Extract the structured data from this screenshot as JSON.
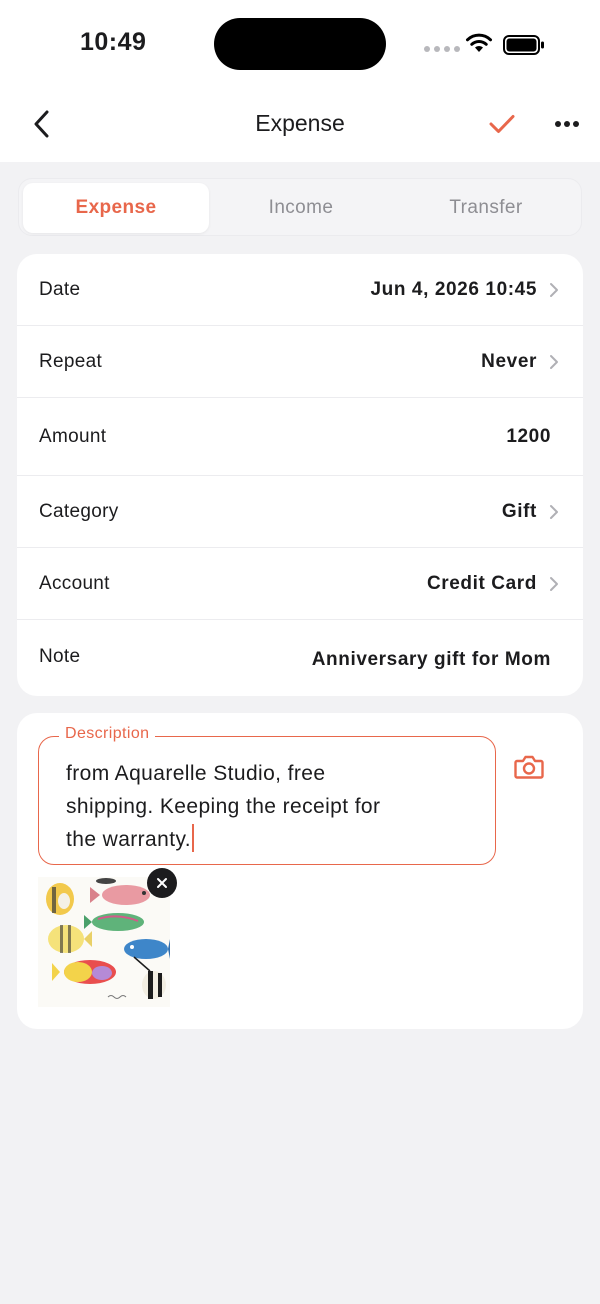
{
  "status_bar": {
    "time": "10:49",
    "icons": [
      "signal-icon",
      "wifi-icon",
      "battery-icon"
    ]
  },
  "nav": {
    "title": "Expense",
    "back_icon": "chevron-left-icon",
    "confirm_icon": "checkmark-icon",
    "more_icon": "ellipsis-icon"
  },
  "tabs": [
    {
      "label": "Expense",
      "active": true
    },
    {
      "label": "Income",
      "active": false
    },
    {
      "label": "Transfer",
      "active": false
    }
  ],
  "form": {
    "date": {
      "label": "Date",
      "value": "Jun 4, 2026 10:45"
    },
    "repeat": {
      "label": "Repeat",
      "value": "Never"
    },
    "amount": {
      "label": "Amount",
      "value": "1200"
    },
    "category": {
      "label": "Category",
      "value": "Gift"
    },
    "account": {
      "label": "Account",
      "value": "Credit Card"
    },
    "note": {
      "label": "Note",
      "value": "Anniversary gift for Mom"
    }
  },
  "description": {
    "label": "Description",
    "lines": [
      "from Aquarelle Studio, free",
      "shipping. Keeping the receipt for",
      "the warranty."
    ],
    "camera_icon": "camera-icon"
  },
  "attachment": {
    "image_icon": "fish-illustration-thumbnail",
    "remove_icon": "close-icon"
  },
  "colors": {
    "accent": "#e8674b",
    "background": "#f2f2f4",
    "card": "#ffffff",
    "text": "#1c1c1e",
    "secondary_text": "#8e8e93"
  }
}
